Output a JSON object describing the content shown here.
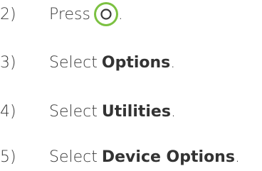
{
  "steps": [
    {
      "number": "2)",
      "verb": "Press",
      "icon": "o-button-icon",
      "suffix": "."
    },
    {
      "number": "3)",
      "verb": "Select",
      "target": "Options",
      "suffix": "."
    },
    {
      "number": "4)",
      "verb": "Select",
      "target": "Utilities",
      "suffix": "."
    },
    {
      "number": "5)",
      "verb": "Select",
      "target": "Device Options",
      "suffix": "."
    }
  ],
  "colors": {
    "button_ring": "#7cc142",
    "text": "#3a3a3a"
  }
}
